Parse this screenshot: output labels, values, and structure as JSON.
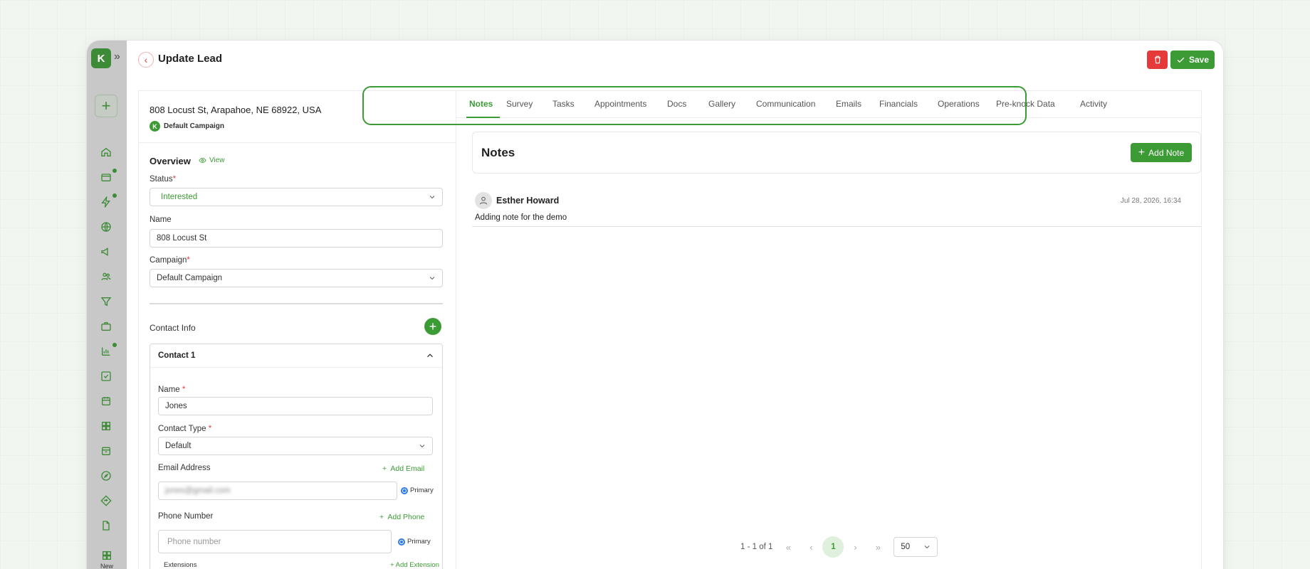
{
  "rail": {
    "logo_letter": "K",
    "new_label": "New"
  },
  "header": {
    "title": "Update Lead",
    "save_label": "Save"
  },
  "lead": {
    "address": "808 Locust St, Arapahoe, NE 68922, USA",
    "campaign_badge": "Default Campaign"
  },
  "overview": {
    "title": "Overview",
    "view_label": "View",
    "status_label": "Status",
    "status_value": "Interested",
    "name_label": "Name",
    "name_value": "808 Locust St",
    "campaign_label": "Campaign",
    "campaign_value": "Default Campaign"
  },
  "contact_info": {
    "title": "Contact Info",
    "contact_title": "Contact 1",
    "name_label": "Name",
    "name_value": "Jones",
    "type_label": "Contact Type",
    "type_value": "Default",
    "email_label": "Email Address",
    "add_email": "Add Email",
    "email_value": "jones@gmail.com",
    "primary_label": "Primary",
    "phone_label": "Phone Number",
    "add_phone": "Add Phone",
    "phone_placeholder": "Phone number",
    "extensions_label": "Extensions",
    "add_extension": "+ Add Extension"
  },
  "tabs": [
    "Notes",
    "Survey",
    "Tasks",
    "Appointments",
    "Docs",
    "Gallery",
    "Communication",
    "Emails",
    "Financials",
    "Operations",
    "Pre-knock Data",
    "Activity"
  ],
  "notes": {
    "title": "Notes",
    "add_label": "Add Note",
    "items": [
      {
        "author": "Esther Howard",
        "date": "Jul 28, 2026, 16:34",
        "text": "Adding note for the demo"
      }
    ]
  },
  "pagination": {
    "range": "1 - 1 of 1",
    "current_page": "1",
    "page_size": "50"
  },
  "colors": {
    "accent": "#3d9b36",
    "danger": "#e5393a",
    "highlight_outline": "#3d9b36"
  }
}
